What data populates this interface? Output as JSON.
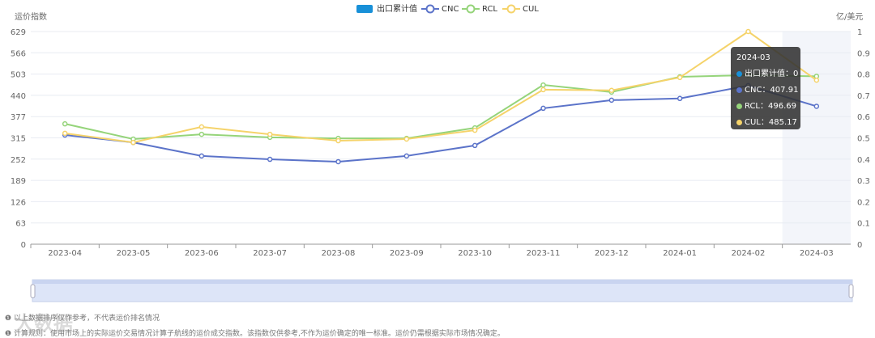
{
  "chart_data": {
    "type": "line",
    "ylabel_left": "运价指数",
    "ylabel_right": "亿/美元",
    "categories": [
      "2023-04",
      "2023-05",
      "2023-06",
      "2023-07",
      "2023-08",
      "2023-09",
      "2023-10",
      "2023-11",
      "2023-12",
      "2024-01",
      "2024-02",
      "2024-03"
    ],
    "yticks_left": [
      "0",
      "63",
      "126",
      "189",
      "252",
      "315",
      "377",
      "440",
      "503",
      "566",
      "629"
    ],
    "yticks_right": [
      "0",
      "0.1",
      "0.2",
      "0.3",
      "0.4",
      "0.5",
      "0.6",
      "0.7",
      "0.8",
      "0.9",
      "1"
    ],
    "ylim": [
      0,
      629
    ],
    "series": [
      {
        "name": "出口累计值",
        "type": "bar",
        "color": "#1890d8",
        "values": [
          0,
          0,
          0,
          0,
          0,
          0,
          0,
          0,
          0,
          0,
          0,
          0
        ]
      },
      {
        "name": "CNC",
        "color": "#5b73c9",
        "values": [
          323,
          301,
          261,
          251,
          244,
          261,
          292,
          402,
          426,
          431,
          469,
          407.91
        ]
      },
      {
        "name": "RCL",
        "color": "#95d47a",
        "values": [
          356,
          311,
          325,
          316,
          313,
          313,
          344,
          471,
          450,
          495,
          500,
          496.69
        ]
      },
      {
        "name": "CUL",
        "color": "#f5d36a",
        "values": [
          328,
          301,
          347,
          325,
          306,
          311,
          337,
          457,
          455,
          493,
          629,
          485.17
        ]
      }
    ],
    "tooltip": {
      "title": "2024-03",
      "rows": [
        {
          "label": "出口累计值：0",
          "color": "#1890d8"
        },
        {
          "label": "CNC：407.91",
          "color": "#5b73c9"
        },
        {
          "label": "RCL：496.69",
          "color": "#95d47a"
        },
        {
          "label": "CUL：485.17",
          "color": "#f5d36a"
        }
      ]
    }
  },
  "notes": [
    "以上数据排序仅作参考，不代表运价排名情况",
    "计算规则：使用市场上的实际运价交易情况计算子航线的运价成交指数。该指数仅供参考,不作为运价确定的唯一标准。运价仍需根据实际市场情况确定。"
  ],
  "watermark": "大数据"
}
